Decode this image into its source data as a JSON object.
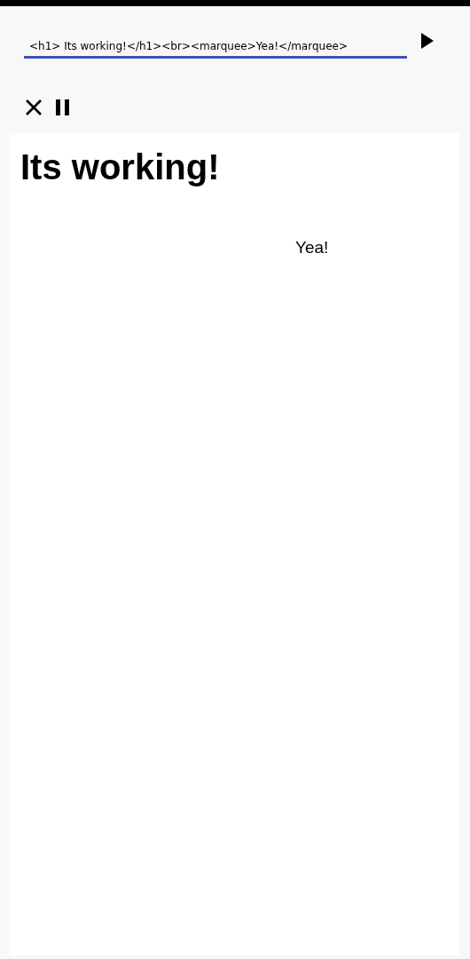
{
  "editor": {
    "value": "<h1> Its working!</h1><br><marquee>Yea!</marquee>"
  },
  "preview": {
    "heading": "Its working!",
    "marquee": "Yea!"
  }
}
